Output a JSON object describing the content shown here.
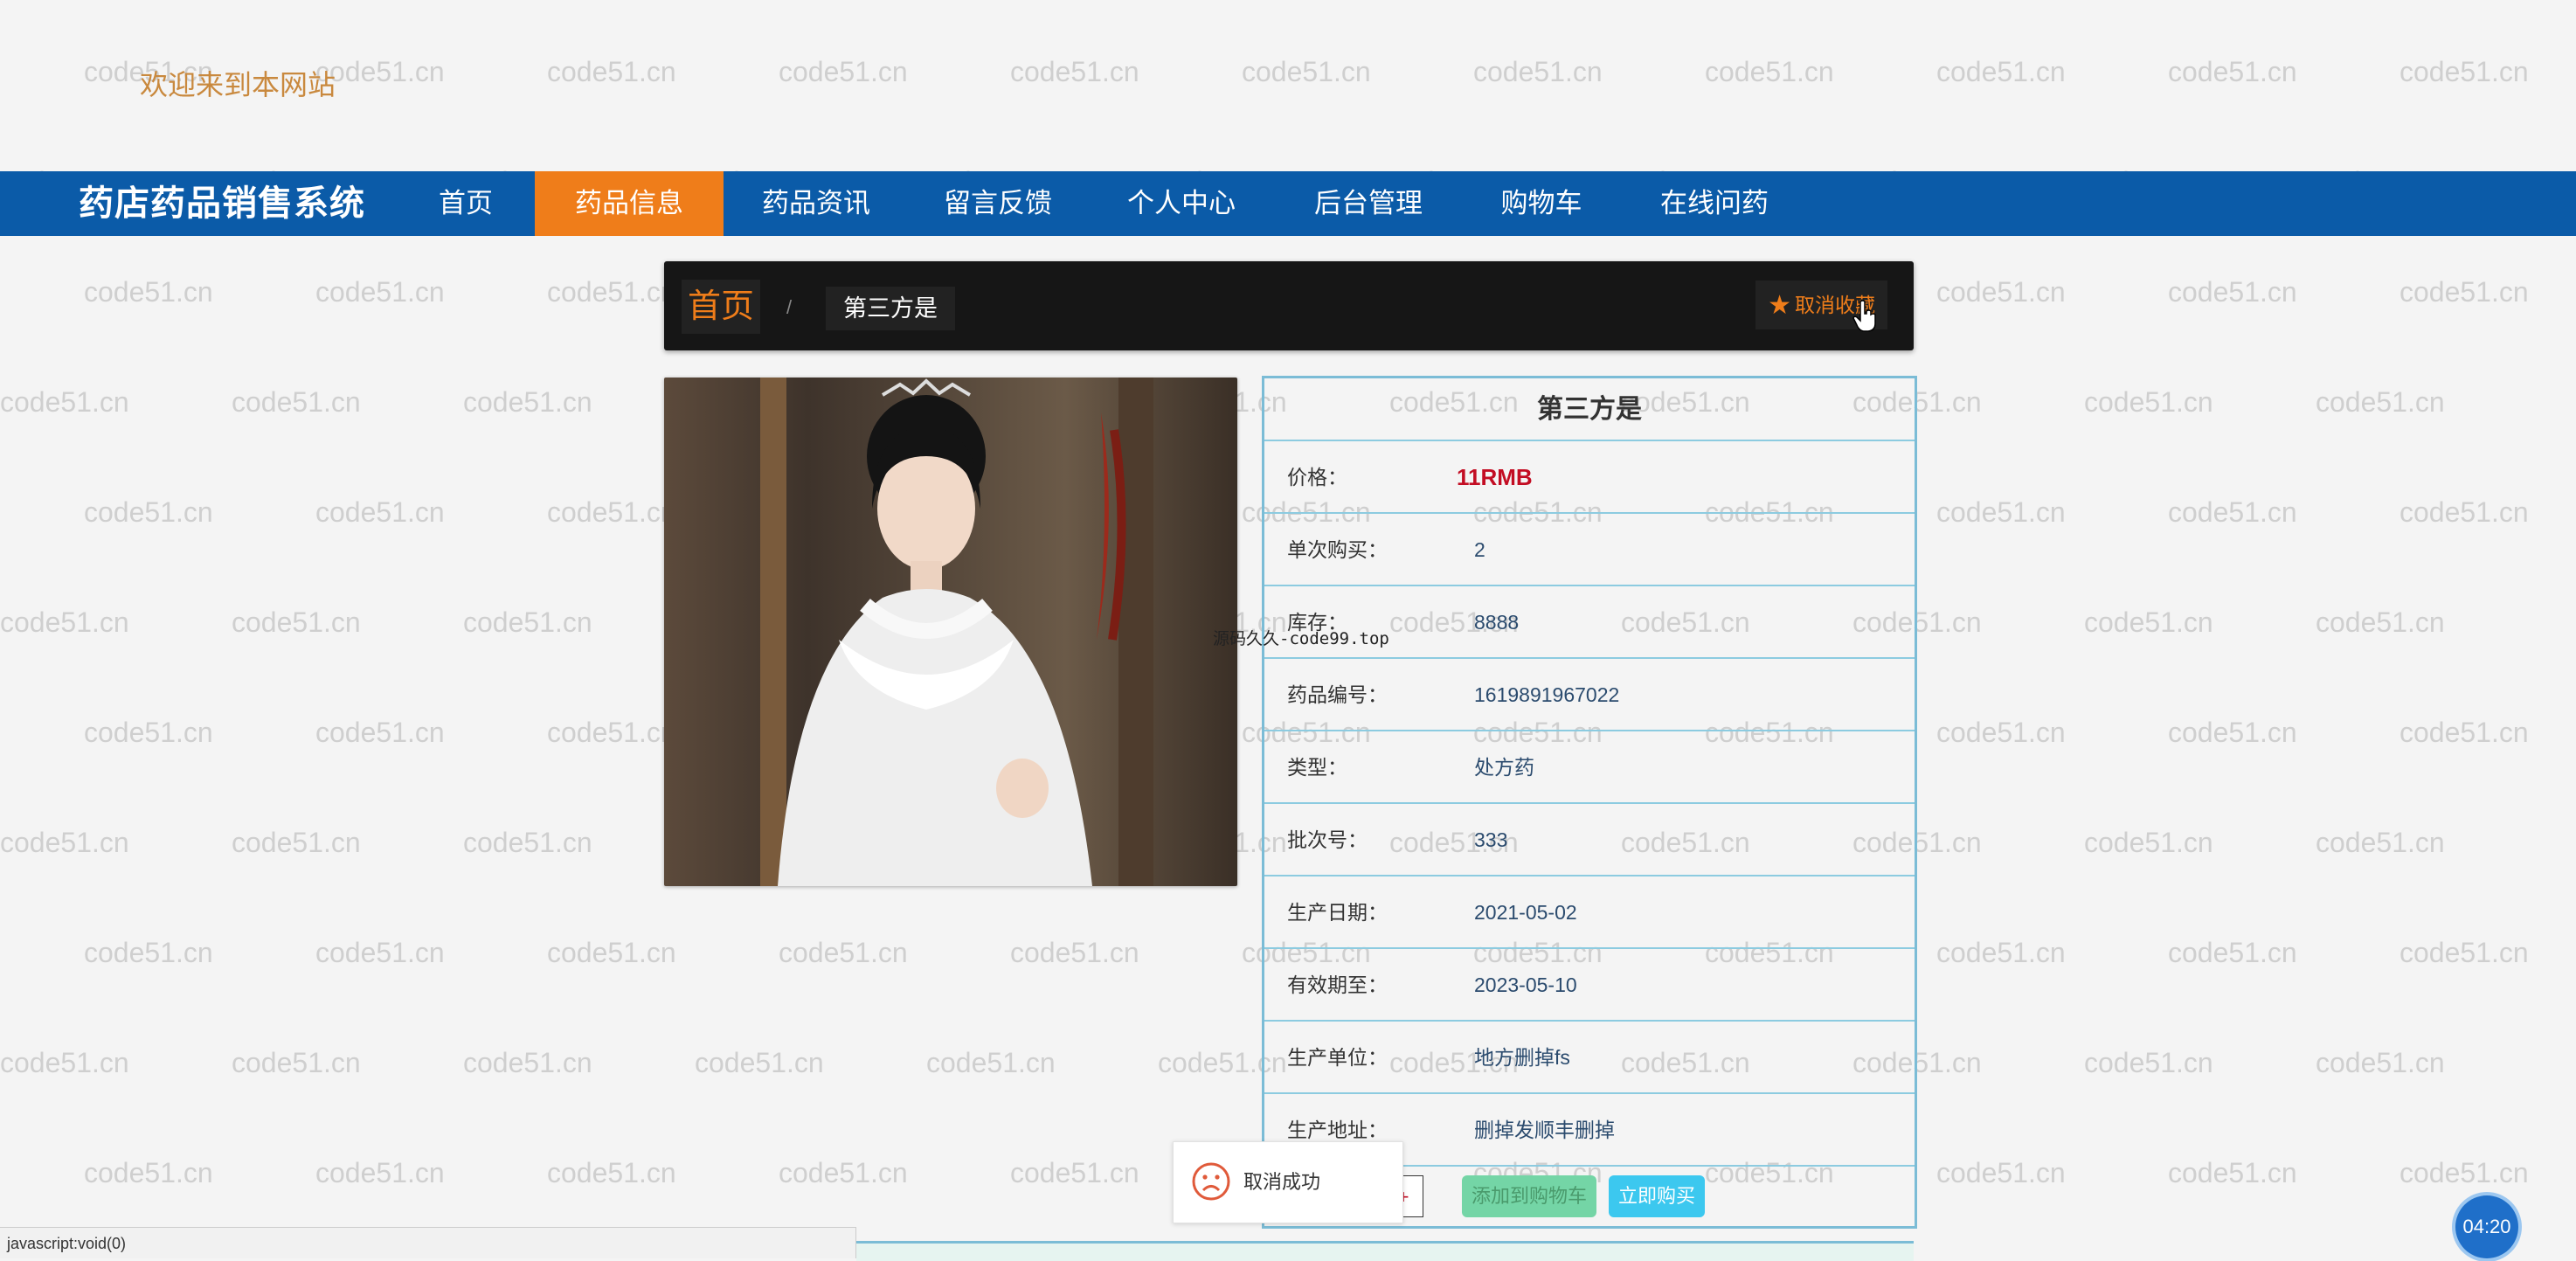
{
  "watermark_text": "code51.cn",
  "header": {
    "welcome": "欢迎来到本网站"
  },
  "nav": {
    "brand": "药店药品销售系统",
    "items": [
      "首页",
      "药品信息",
      "药品资讯",
      "留言反馈",
      "个人中心",
      "后台管理",
      "购物车",
      "在线问药"
    ],
    "active_index": 1
  },
  "breadcrumb": {
    "home": "首页",
    "separator": "/",
    "current": "第三方是",
    "favorite_label": "取消收藏"
  },
  "product": {
    "name": "第三方是",
    "image_alt_icon": "product-photo",
    "fields": [
      {
        "label": "价格：",
        "value": "11RMB"
      },
      {
        "label": "单次购买：",
        "value": "2"
      },
      {
        "label": "库存：",
        "value": "8888"
      },
      {
        "label": "药品编号：",
        "value": "1619891967022"
      },
      {
        "label": "类型：",
        "value": "处方药"
      },
      {
        "label": "批次号：",
        "value": "333"
      },
      {
        "label": "生产日期：",
        "value": "2021-05-02"
      },
      {
        "label": "有效期至：",
        "value": "2023-05-10"
      },
      {
        "label": "生产单位：",
        "value": "地方删掉fs"
      },
      {
        "label": "生产地址：",
        "value": "删掉发顺丰删掉"
      }
    ],
    "qty_plus": "+",
    "add_to_cart": "添加到购物车",
    "buy_now": "立即购买"
  },
  "overlay_text": "源码久久-code99.top",
  "toast": {
    "message": "取消成功",
    "icon": "sad-face-icon"
  },
  "status_bar": "javascript:void(0)",
  "timer": "04:20",
  "colors": {
    "nav_bg": "#0b5ba8",
    "active": "#ef7d1a",
    "price": "#c30d23",
    "border": "#7bbcd6"
  }
}
